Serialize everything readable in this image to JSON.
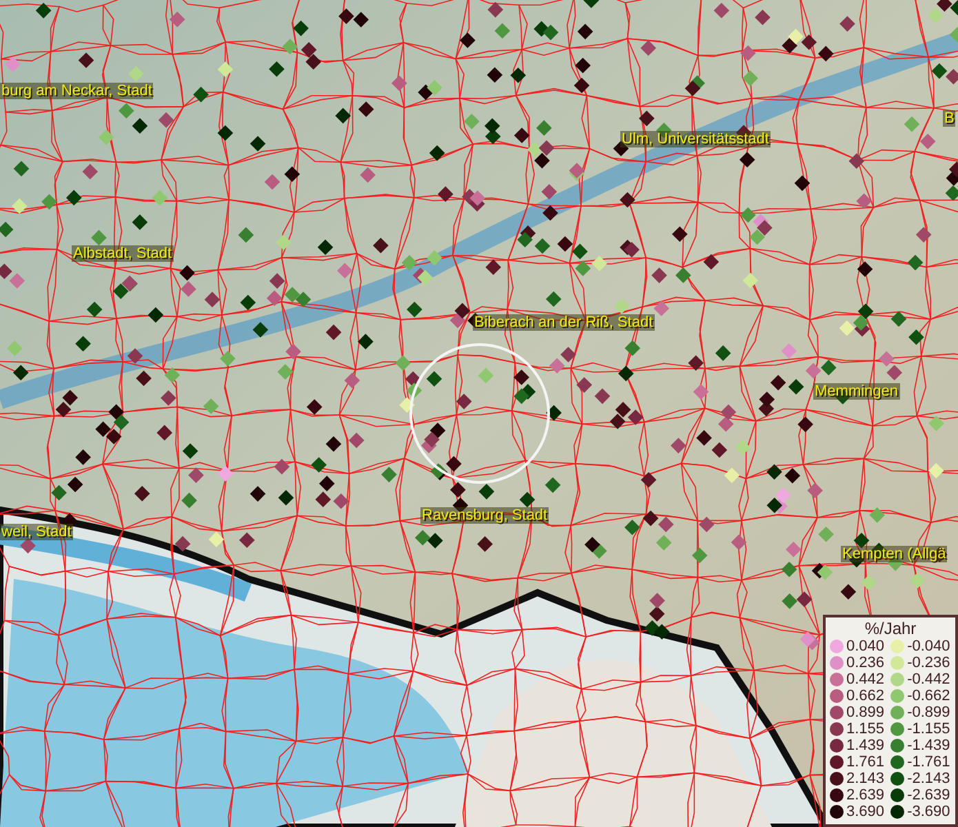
{
  "map": {
    "place_labels": [
      {
        "text": "burg am Neckar, Stadt",
        "kind": "city"
      },
      {
        "text": "Ulm, Universitätsstadt",
        "kind": "city"
      },
      {
        "text": "B",
        "kind": "city"
      },
      {
        "text": "Albstadt, Stadt",
        "kind": "city"
      },
      {
        "text": "Biberach an der Riß, Stadt",
        "kind": "city"
      },
      {
        "text": "Memmingen",
        "kind": "city"
      },
      {
        "text": "Ravensburg, Stadt",
        "kind": "city"
      },
      {
        "text": "weil, Stadt",
        "kind": "city"
      },
      {
        "text": "Kempten (Allgä",
        "kind": "city"
      }
    ]
  },
  "legend": {
    "title": "%/Jahr",
    "rows": [
      {
        "positive": {
          "value": "0.040",
          "color": "#f0a8e0"
        },
        "negative": {
          "value": "-0.040",
          "color": "#e8f0a8"
        }
      },
      {
        "positive": {
          "value": "0.236",
          "color": "#e090c8"
        },
        "negative": {
          "value": "-0.236",
          "color": "#d0e898"
        }
      },
      {
        "positive": {
          "value": "0.442",
          "color": "#c87098"
        },
        "negative": {
          "value": "-0.442",
          "color": "#b0d888"
        }
      },
      {
        "positive": {
          "value": "0.662",
          "color": "#b85c80"
        },
        "negative": {
          "value": "-0.662",
          "color": "#90c870"
        }
      },
      {
        "positive": {
          "value": "0.899",
          "color": "#a04868"
        },
        "negative": {
          "value": "-0.899",
          "color": "#70b058"
        }
      },
      {
        "positive": {
          "value": "1.155",
          "color": "#883850"
        },
        "negative": {
          "value": "-1.155",
          "color": "#509840"
        }
      },
      {
        "positive": {
          "value": "1.439",
          "color": "#782840"
        },
        "negative": {
          "value": "-1.439",
          "color": "#388030"
        }
      },
      {
        "positive": {
          "value": "1.761",
          "color": "#601828"
        },
        "negative": {
          "value": "-1.761",
          "color": "#206820"
        }
      },
      {
        "positive": {
          "value": "2.143",
          "color": "#481018"
        },
        "negative": {
          "value": "-2.143",
          "color": "#105010"
        }
      },
      {
        "positive": {
          "value": "2.639",
          "color": "#380810"
        },
        "negative": {
          "value": "-2.639",
          "color": "#083c08"
        }
      },
      {
        "positive": {
          "value": "3.690",
          "color": "#200408"
        },
        "negative": {
          "value": "-3.690",
          "color": "#042804"
        }
      }
    ]
  }
}
